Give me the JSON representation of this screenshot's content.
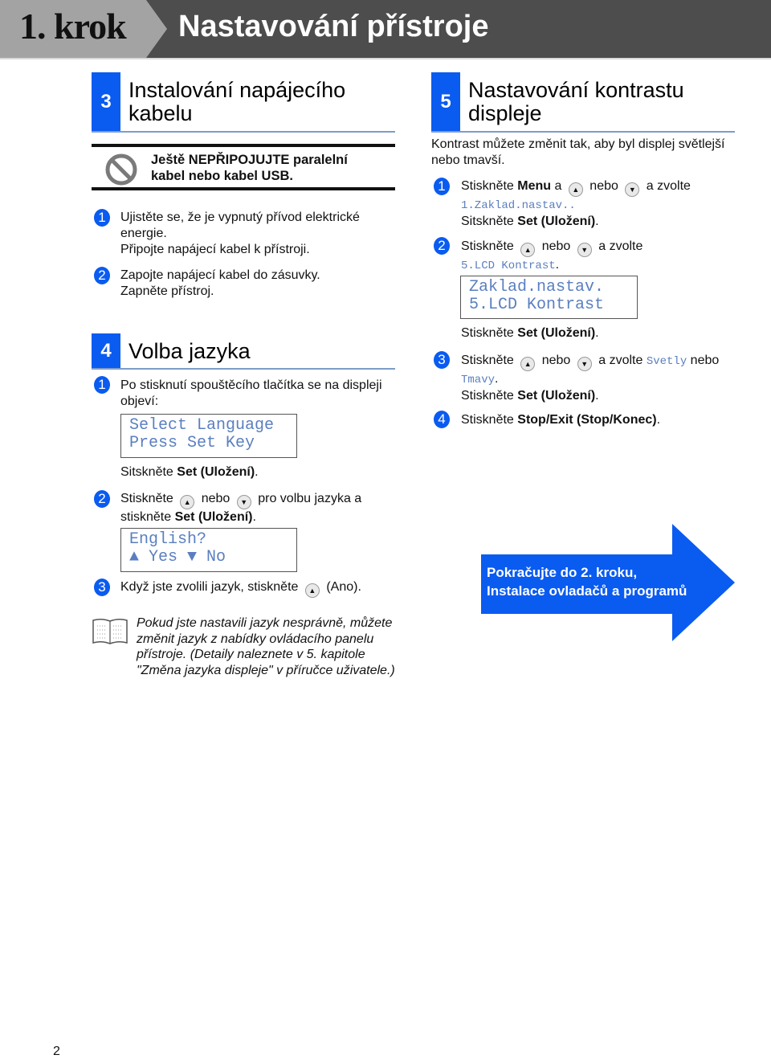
{
  "header": {
    "step_label": "1. krok",
    "title": "Nastavování přístroje"
  },
  "section3": {
    "number": "3",
    "title_line1": "Instalování napájecího",
    "title_line2": "kabelu",
    "warning_icon": "prohibited-icon",
    "warning_line1": "Ještě NEPŘIPOJUJTE paralelní",
    "warning_line2": "kabel nebo kabel USB.",
    "steps": [
      {
        "num": "1",
        "lines": [
          "Ujistěte se, že je vypnutý přívod elektrické",
          "energie.",
          "Připojte napájecí kabel k přístroji."
        ]
      },
      {
        "num": "2",
        "lines": [
          "Zapojte napájecí kabel do zásuvky.",
          "Zapněte přístroj."
        ]
      }
    ]
  },
  "section4": {
    "number": "4",
    "title": "Volba jazyka",
    "step1": {
      "num": "1",
      "line1": "Po stisknutí spouštěcího tlačítka se na displeji",
      "line2": "objeví:",
      "lcd_line1": "Select Language",
      "lcd_line2": "Press Set Key",
      "after_prefix": "Sitskněte ",
      "after_bold": "Set (Uložení)",
      "after_suffix": "."
    },
    "step2": {
      "num": "2",
      "prefix": "Stiskněte",
      "mid": "nebo",
      "suffix": "pro volbu jazyka a",
      "line2_prefix": "stiskněte ",
      "line2_bold": "Set (Uložení)",
      "line2_suffix": ".",
      "lcd_line1": "English?",
      "lcd_line2": "▲ Yes ▼ No"
    },
    "step3": {
      "num": "3",
      "prefix": "Když jste zvolili jazyk, stiskněte",
      "suffix": "(Ano)."
    }
  },
  "note": {
    "icon": "book-icon",
    "text": "Pokud jste nastavili jazyk nesprávně, můžete změnit jazyk z nabídky ovládacího panelu přístroje. (Detaily naleznete v 5. kapitole \"Změna jazyka displeje\" v příručce uživatele.)"
  },
  "section5": {
    "number": "5",
    "title_line1": "Nastavování kontrastu",
    "title_line2": "displeje",
    "intro_line1": "Kontrast můžete změnit tak, aby byl displej světlejší",
    "intro_line2": "nebo tmavší.",
    "step1": {
      "num": "1",
      "prefix": "Stiskněte ",
      "bold": "Menu",
      "a": " a",
      "mid": "nebo",
      "suffix": "a zvolte",
      "mono": "1.Zaklad.nastav.",
      "mono_suffix": ".",
      "line3_prefix": "Sitskněte ",
      "line3_bold": "Set (Uložení)",
      "line3_suffix": "."
    },
    "step2": {
      "num": "2",
      "prefix": "Stiskněte",
      "mid": "nebo",
      "suffix": "a zvolte",
      "mono": "5.LCD Kontrast",
      "mono_suffix": ".",
      "lcd_line1": "Zaklad.nastav.",
      "lcd_line2": "5.LCD Kontrast",
      "after_prefix": "Stiskněte ",
      "after_bold": "Set (Uložení)",
      "after_suffix": "."
    },
    "step3": {
      "num": "3",
      "prefix": "Stiskněte",
      "mid": "nebo",
      "suffix": "a zvolte ",
      "mono1": "Svetly",
      "or": " nebo",
      "mono2": "Tmavy",
      "mono2_suffix": ".",
      "line3_prefix": "Stiskněte ",
      "line3_bold": "Set (Uložení)",
      "line3_suffix": "."
    },
    "step4": {
      "num": "4",
      "prefix": "Stiskněte ",
      "bold": "Stop/Exit (Stop/Konec)",
      "suffix": "."
    }
  },
  "continue_arrow": {
    "line1": "Pokračujte do 2. kroku,",
    "line2": "Instalace ovladačů a programů"
  },
  "page_number": "2",
  "icons": {
    "up": "▲",
    "down": "▼"
  }
}
